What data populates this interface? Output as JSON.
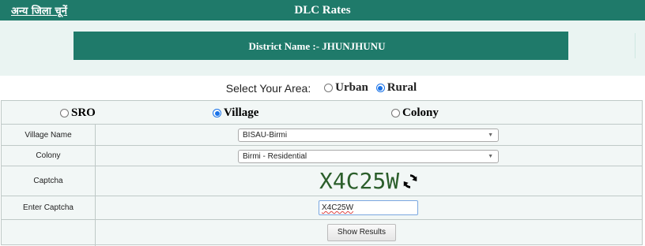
{
  "header": {
    "other_districts_link": "अन्य जिला चूनें",
    "title": "DLC Rates"
  },
  "district": {
    "label": "District Name :- JHUNJHUNU"
  },
  "area": {
    "label": "Select Your Area:",
    "options": [
      {
        "label": "Urban",
        "selected": false
      },
      {
        "label": "Rural",
        "selected": true
      }
    ]
  },
  "location_type": {
    "options": [
      {
        "label": "SRO",
        "selected": false
      },
      {
        "label": "Village",
        "selected": true
      },
      {
        "label": "Colony",
        "selected": false
      }
    ]
  },
  "form": {
    "village_label": "Village Name",
    "village_value": "BISAU-Birmi",
    "colony_label": "Colony",
    "colony_value": "Birmi - Residential",
    "captcha_label": "Captcha",
    "captcha_text": "X4C25W",
    "enter_captcha_label": "Enter Captcha",
    "enter_captcha_value": "X4C25W",
    "show_results_label": "Show Results"
  },
  "colors": {
    "header_bg": "#1f7a6a",
    "band_bg": "#eaf4f2",
    "radio_selected": "#1a73e8",
    "captcha_color": "#2b5e2b"
  },
  "icons": {
    "refresh": "refresh-icon",
    "dropdown": "chevron-down-icon"
  }
}
